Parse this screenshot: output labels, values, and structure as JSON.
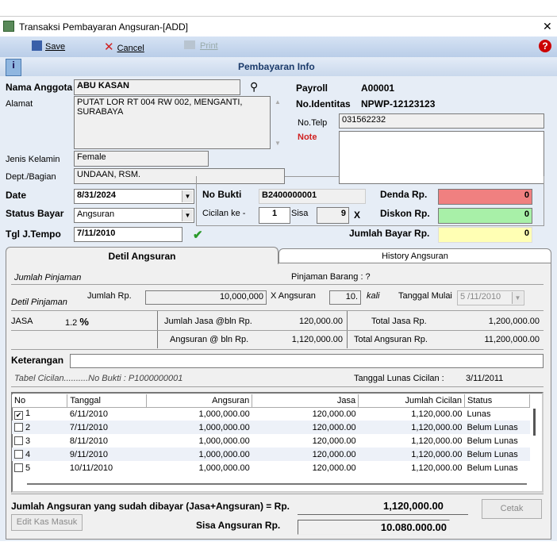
{
  "window": {
    "title": "Transaksi Pembayaran Angsuran-[ADD]",
    "close": "✕"
  },
  "toolbar": {
    "save": "Save",
    "cancel": "Cancel",
    "print": "Print",
    "help": "?"
  },
  "section_title": "Pembayaran Info",
  "member": {
    "nama_label": "Nama Anggota",
    "nama": "ABU KASAN",
    "alamat_label": "Alamat",
    "alamat": "PUTAT LOR RT 004 RW 002, MENGANTI, SURABAYA",
    "jk_label": "Jenis Kelamin",
    "jk": "Female",
    "dept_label": "Dept./Bagian",
    "dept": "UNDAAN, RSM.",
    "payroll_label": "Payroll",
    "payroll": "A00001",
    "id_label": "No.Identitas",
    "id": "NPWP-12123123",
    "telp_label": "No.Telp",
    "telp": "031562232",
    "note_label": "Note",
    "note": ""
  },
  "payment": {
    "date_label": "Date",
    "date": "8/31/2024",
    "status_label": "Status Bayar",
    "status": "Angsuran",
    "tempo_label": "Tgl J.Tempo",
    "tempo": "7/11/2010",
    "bukti_label": "No Bukti",
    "bukti": "B2400000001",
    "cicilan_label": "Cicilan ke -",
    "cicilan": "1",
    "sisa_label": "Sisa",
    "sisa": "9",
    "x_label": "X",
    "denda_label": "Denda Rp.",
    "denda": "0",
    "diskon_label": "Diskon Rp.",
    "diskon": "0",
    "jumlah_label": "Jumlah Bayar Rp.",
    "jumlah": "0"
  },
  "colors": {
    "denda": "#f08080",
    "diskon": "#a8f0a8",
    "jumlah": "#ffffb4"
  },
  "tabs": [
    {
      "label": "Detil Angsuran",
      "active": true
    },
    {
      "label": "History Angsuran",
      "active": false
    }
  ],
  "detail": {
    "jumlah_pinjaman": "Jumlah Pinjaman",
    "pinjaman_barang": "Pinjaman Barang :  ?",
    "detil_pinjaman": "Detil Pinjaman",
    "jumlah_rp_label": "Jumlah Rp.",
    "jumlah_rp": "10,000,000",
    "x_angsuran_label": "X Angsuran",
    "x_angsuran": "10.",
    "kali": "kali",
    "tgl_mulai_label": "Tanggal Mulai",
    "tgl_mulai": "5 /11/2010",
    "jasa_label": "JASA",
    "jasa_pct": "1.2",
    "pct": "%",
    "jasa_bln_label": "Jumlah Jasa @bln Rp.",
    "jasa_bln": "120,000.00",
    "total_jasa_label": "Total Jasa Rp.",
    "total_jasa": "1,200,000.00",
    "angs_bln_label": "Angsuran @ bln  Rp.",
    "angs_bln": "1,120,000.00",
    "total_angs_label": "Total Angsuran Rp.",
    "total_angs": "11,200,000.00",
    "keterangan_label": "Keterangan",
    "keterangan": "",
    "tabel_label": "Tabel Cicilan..........No Bukti : P1000000001",
    "lunas_label": "Tanggal Lunas Cicilan :",
    "lunas": "3/11/2011"
  },
  "grid": {
    "columns": [
      "No",
      "Tanggal",
      "Angsuran",
      "Jasa",
      "Jumlah Cicilan",
      "Status"
    ],
    "rows": [
      {
        "checked": true,
        "no": "1",
        "tanggal": "6/11/2010",
        "angsuran": "1,000,000.00",
        "jasa": "120,000.00",
        "jumlah": "1,120,000.00",
        "status": "Lunas"
      },
      {
        "checked": false,
        "no": "2",
        "tanggal": "7/11/2010",
        "angsuran": "1,000,000.00",
        "jasa": "120,000.00",
        "jumlah": "1,120,000.00",
        "status": "Belum Lunas"
      },
      {
        "checked": false,
        "no": "3",
        "tanggal": "8/11/2010",
        "angsuran": "1,000,000.00",
        "jasa": "120,000.00",
        "jumlah": "1,120,000.00",
        "status": "Belum Lunas"
      },
      {
        "checked": false,
        "no": "4",
        "tanggal": "9/11/2010",
        "angsuran": "1,000,000.00",
        "jasa": "120,000.00",
        "jumlah": "1,120,000.00",
        "status": "Belum Lunas"
      },
      {
        "checked": false,
        "no": "5",
        "tanggal": "10/11/2010",
        "angsuran": "1,000,000.00",
        "jasa": "120,000.00",
        "jumlah": "1,120,000.00",
        "status": "Belum Lunas"
      }
    ]
  },
  "footer": {
    "dibayar_label": "Jumlah Angsuran yang sudah dibayar (Jasa+Angsuran) = Rp.",
    "dibayar": "1,120,000.00",
    "cetak": "Cetak",
    "edit_kas": "Edit Kas Masuk",
    "sisa_label": "Sisa Angsuran Rp.",
    "sisa": "10.080.000.00"
  }
}
